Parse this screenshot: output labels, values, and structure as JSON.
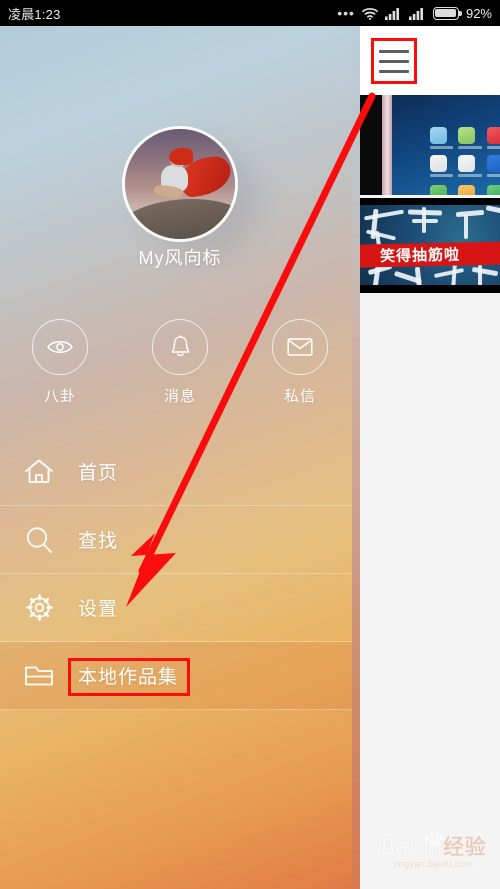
{
  "status_bar": {
    "time": "凌晨1:23",
    "dots": "•••",
    "icons": [
      "wifi-icon",
      "signal-icon",
      "signal-icon",
      "battery-icon"
    ],
    "battery_percent": "92%"
  },
  "drawer": {
    "avatar": {
      "name": "avatar",
      "alt": "child in red cape on rock"
    },
    "username": "My风向标",
    "quick_actions": [
      {
        "icon": "eye-icon",
        "label": "八卦"
      },
      {
        "icon": "bell-icon",
        "label": "消息"
      },
      {
        "icon": "envelope-icon",
        "label": "私信"
      }
    ],
    "menu_items": [
      {
        "icon": "home-icon",
        "label": "首页",
        "selected": false
      },
      {
        "icon": "search-icon",
        "label": "查找",
        "selected": false
      },
      {
        "icon": "gear-icon",
        "label": "设置",
        "selected": false
      },
      {
        "icon": "folder-icon",
        "label": "本地作品集",
        "selected": true
      }
    ]
  },
  "app_panel": {
    "menu_button": "hamburger-icon",
    "thumbnails": [
      {
        "name": "phone-homescreen-thumbnail",
        "caption": ""
      },
      {
        "name": "calligraphy-video-thumbnail",
        "caption": "笑得抽筋啦"
      }
    ]
  },
  "annotations": {
    "highlight_color": "#fb0d0d",
    "arrow_color": "#fb0d0d",
    "boxes": [
      "hamburger-icon",
      "本地作品集"
    ],
    "arrow": {
      "from": "hamburger-icon",
      "to": "本地作品集"
    }
  },
  "watermark": {
    "brand": "Baidu",
    "brand_cn": "经验",
    "url": "jingyan.baidu.com"
  }
}
